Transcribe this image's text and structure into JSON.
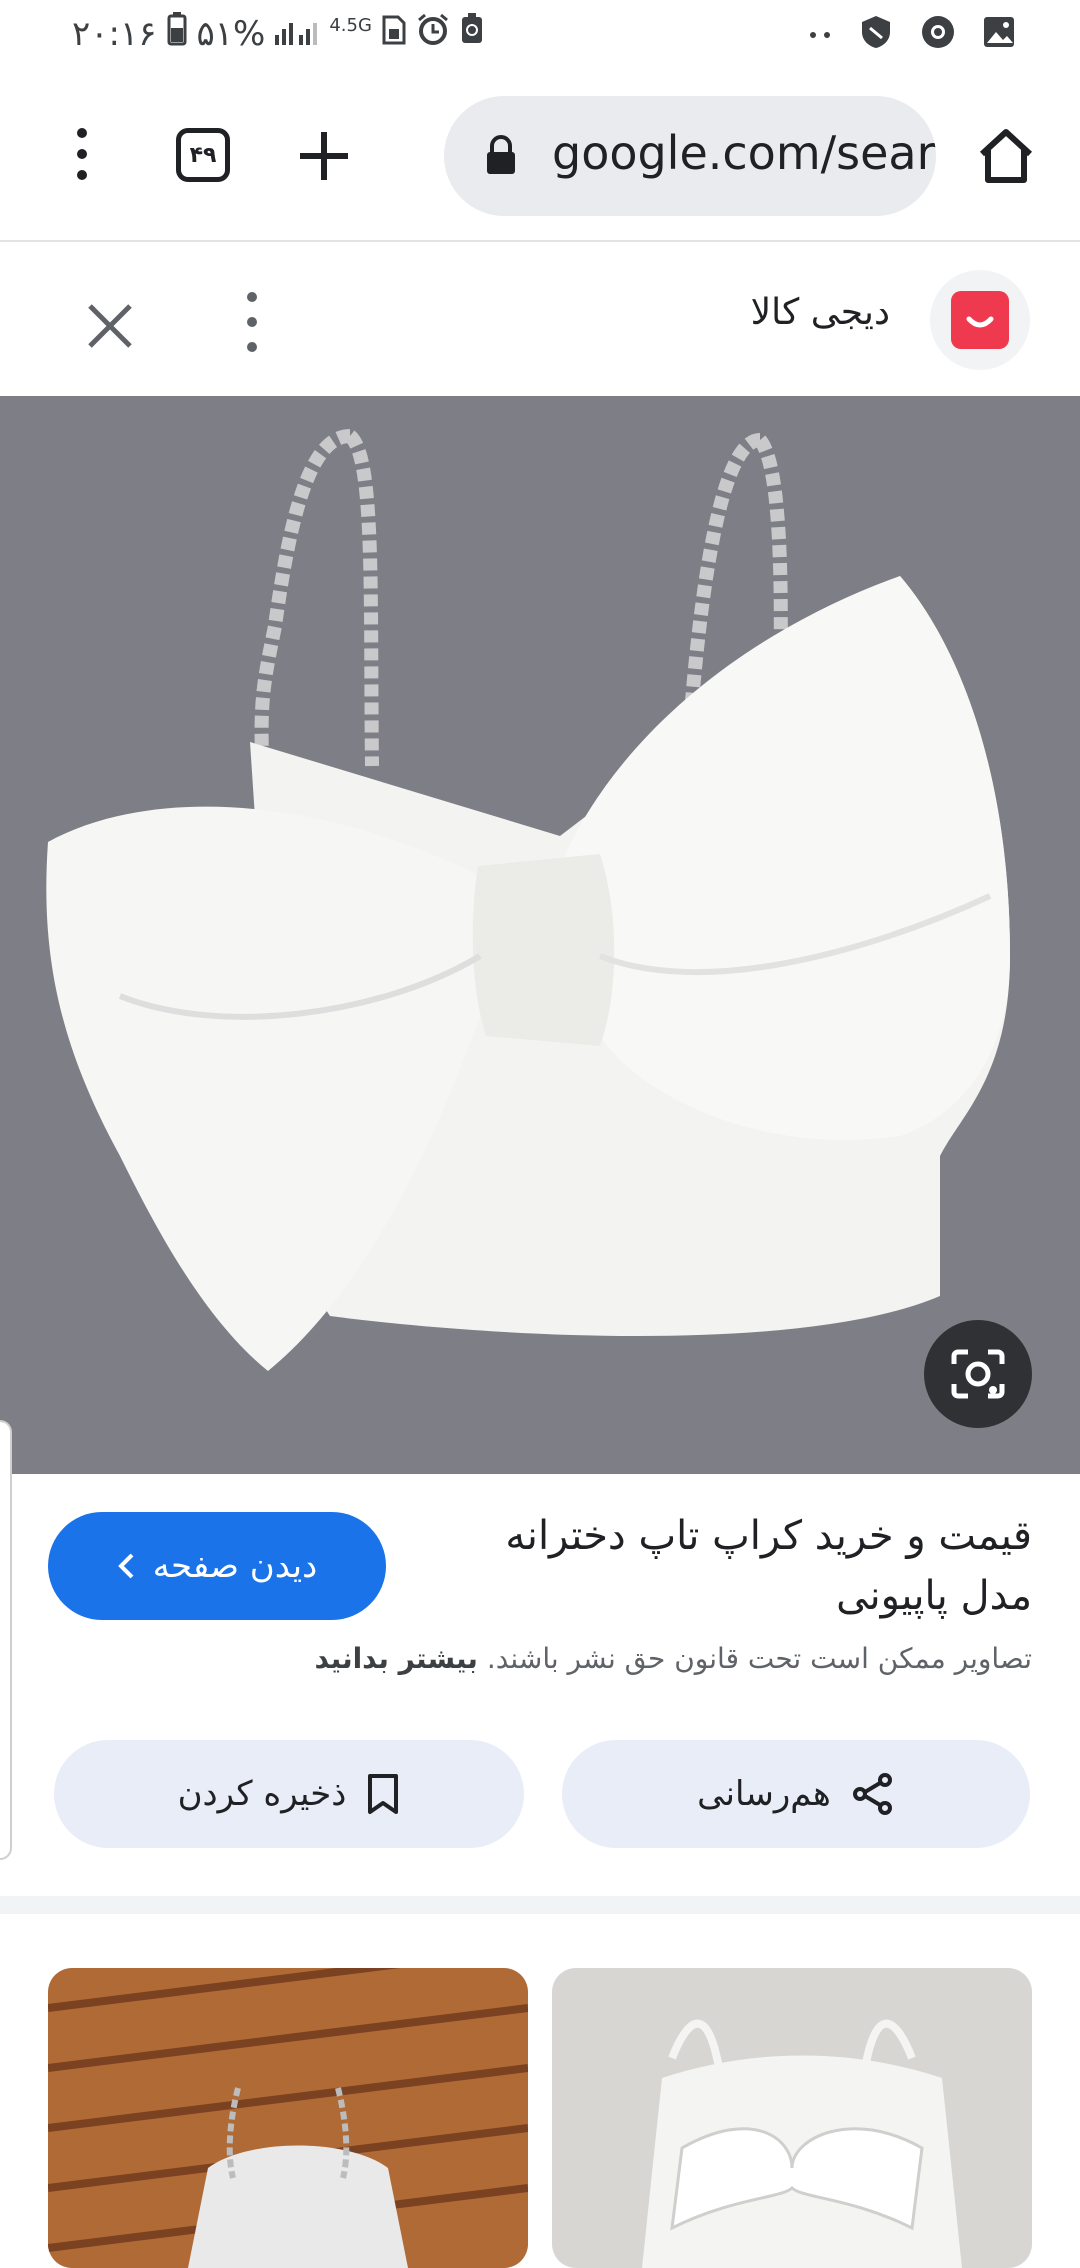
{
  "status_bar": {
    "time": "۲۰:۱۶",
    "battery": "۵۱%",
    "network": "4.5G"
  },
  "toolbar": {
    "tab_count": "۴۹",
    "url": "google.com/sear"
  },
  "result": {
    "site_name": "دیجی کالا",
    "title_line1": "قیمت و خرید کراپ تاپ دخترانه",
    "title_line2": "مدل پاپیونی",
    "visit_label": "دیدن صفحه",
    "copyright_text": "تصاویر ممکن است تحت قانون حق نشر باشند.",
    "learn_more": "بیشتر بدانید",
    "share_label": "هم‌رسانی",
    "save_label": "ذخیره کردن"
  },
  "colors": {
    "accent_blue": "#1a73e8",
    "digikala_red": "#ef394e",
    "pill_bg": "#e8edf7"
  }
}
